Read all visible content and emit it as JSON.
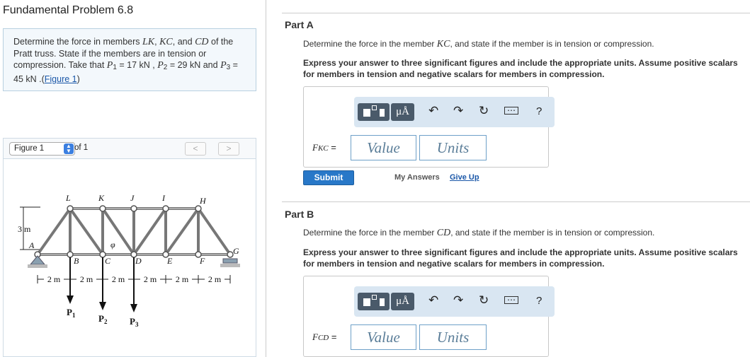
{
  "problem": {
    "title": "Fundamental Problem 6.8",
    "statement": {
      "t1": "Determine the force in members ",
      "m1": "LK",
      "t2": ", ",
      "m2": "KC",
      "t3": ", and ",
      "m3": "CD",
      "t4": " of the Pratt truss. State if the members are in tension or compression. Take that ",
      "p1": "P",
      "s1": "1",
      "t5": " = 17 kN , ",
      "p2": "P",
      "s2": "2",
      "t6": " = 29 kN and ",
      "p3": "P",
      "s3": "3",
      "t7": " = 45 kN .(",
      "link": "Figure 1",
      "t8": ")"
    }
  },
  "figure_nav": {
    "select_value": "Figure 1",
    "of_text": "of 1",
    "prev": "<",
    "next": ">"
  },
  "figure": {
    "top_labels": [
      "L",
      "K",
      "J",
      "I",
      "H"
    ],
    "bottom_labels": [
      "B",
      "C",
      "D",
      "E",
      "F"
    ],
    "left_support": "A",
    "right_support": "G",
    "height_label": "3 m",
    "angle_label": "φ",
    "spacing_labels": [
      "2 m",
      "2 m",
      "2 m",
      "2 m",
      "2 m",
      "2 m"
    ],
    "loads": [
      {
        "label": "P",
        "sub": "1"
      },
      {
        "label": "P",
        "sub": "2"
      },
      {
        "label": "P",
        "sub": "3"
      }
    ]
  },
  "parts": [
    {
      "title": "Part A",
      "instruction_pre": "Determine the force in the member ",
      "member": "KC",
      "instruction_post": ", and state if the member is in tension or compression.",
      "express": "Express your answer to three significant figures and include the appropriate units. Assume positive scalars for members in tension and negative scalars for members in compression.",
      "var": "F",
      "var_sub": "KC",
      "value_placeholder": "Value",
      "units_placeholder": "Units",
      "submit_label": "Submit",
      "my_answers": "My Answers",
      "give_up": "Give Up"
    },
    {
      "title": "Part B",
      "instruction_pre": "Determine the force in the member ",
      "member": "CD",
      "instruction_post": ", and state if the member is in tension or compression.",
      "express": "Express your answer to three significant figures and include the appropriate units. Assume positive scalars for members in tension and negative scalars for members in compression.",
      "var": "F",
      "var_sub": "CD",
      "value_placeholder": "Value",
      "units_placeholder": "Units"
    }
  ],
  "toolbar": {
    "mu_label": "μÅ",
    "help_label": "?",
    "icons": [
      "templates-icon",
      "units-icon",
      "undo-icon",
      "redo-icon",
      "reset-icon",
      "keyboard-icon",
      "help-icon"
    ]
  }
}
